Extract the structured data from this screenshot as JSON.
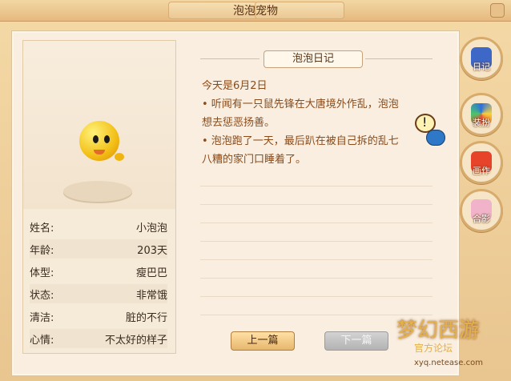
{
  "window": {
    "title": "泡泡宠物"
  },
  "pet": {
    "stats": [
      {
        "label": "姓名:",
        "value": "小泡泡"
      },
      {
        "label": "年龄:",
        "value": "203天"
      },
      {
        "label": "体型:",
        "value": "瘦巴巴"
      },
      {
        "label": "状态:",
        "value": "非常饿"
      },
      {
        "label": "清洁:",
        "value": "脏的不行"
      },
      {
        "label": "心情:",
        "value": "不太好的样子"
      }
    ]
  },
  "diary": {
    "title": "泡泡日记",
    "date_line": "今天是6月2日",
    "entries": [
      "• 听闻有一只鼠先锋在大唐境外作乱，泡泡",
      "想去惩恶扬善。",
      "• 泡泡跑了一天，最后趴在被自己拆的乱七",
      "八糟的家门口睡着了。"
    ],
    "prev_button": "上一篇",
    "next_button": "下一篇"
  },
  "side_tabs": [
    {
      "label": "日记",
      "icon": "diary-icon"
    },
    {
      "label": "装扮",
      "icon": "pinwheel-icon"
    },
    {
      "label": "画作",
      "icon": "painting-icon"
    },
    {
      "label": "合影",
      "icon": "photo-icon"
    }
  ],
  "watermark": {
    "logo_text": "梦幻西游",
    "sub_text": "官方论坛",
    "url": "xyq.netease.com"
  }
}
